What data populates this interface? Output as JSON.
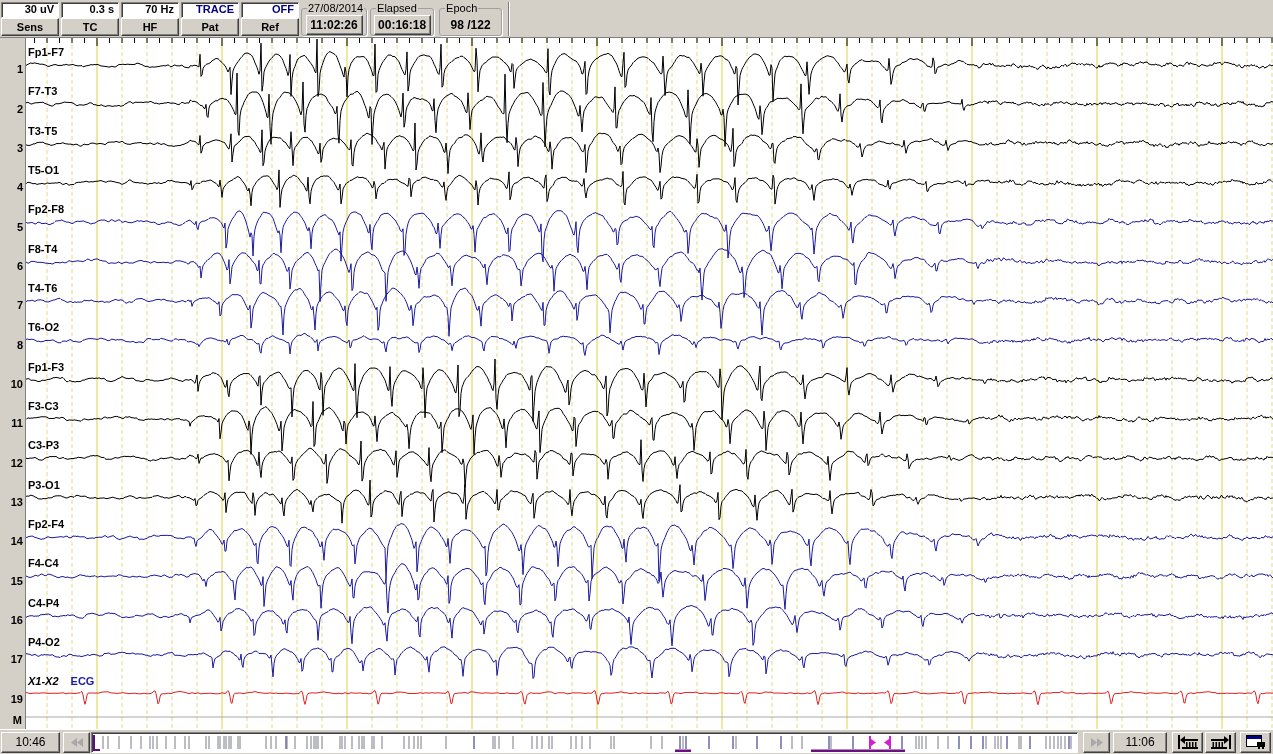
{
  "toolbar": {
    "controls": [
      {
        "value": "30 uV",
        "color": "#000000",
        "button": "Sens"
      },
      {
        "value": "0.3 s",
        "color": "#000000",
        "button": "TC"
      },
      {
        "value": "70 Hz",
        "color": "#000000",
        "button": "HF"
      },
      {
        "value": "TRACE",
        "color": "#000080",
        "button": "Pat"
      },
      {
        "value": "OFF",
        "color": "#000080",
        "button": "Ref"
      }
    ],
    "clock": {
      "legend": "27/08/2014",
      "value": "11:02:26"
    },
    "elapsed": {
      "legend": "Elapsed",
      "value": "00:16:18"
    },
    "epoch": {
      "legend": "Epoch",
      "value": "98 /122"
    }
  },
  "channels": [
    {
      "number": "1",
      "label": "Fp1-F7",
      "kind": "eeg",
      "color": "#000000"
    },
    {
      "number": "2",
      "label": "F7-T3",
      "kind": "eeg",
      "color": "#000000"
    },
    {
      "number": "3",
      "label": "T3-T5",
      "kind": "eeg",
      "color": "#000000"
    },
    {
      "number": "4",
      "label": "T5-O1",
      "kind": "eeg",
      "color": "#000000"
    },
    {
      "number": "5",
      "label": "Fp2-F8",
      "kind": "eeg",
      "color": "#1a1aa0"
    },
    {
      "number": "6",
      "label": "F8-T4",
      "kind": "eeg",
      "color": "#1a1aa0"
    },
    {
      "number": "7",
      "label": "T4-T6",
      "kind": "eeg",
      "color": "#1a1aa0"
    },
    {
      "number": "8",
      "label": "T6-O2",
      "kind": "eeg",
      "color": "#1a1aa0"
    },
    {
      "number": "10",
      "label": "Fp1-F3",
      "kind": "eeg",
      "color": "#000000"
    },
    {
      "number": "11",
      "label": "F3-C3",
      "kind": "eeg",
      "color": "#000000"
    },
    {
      "number": "12",
      "label": "C3-P3",
      "kind": "eeg",
      "color": "#000000"
    },
    {
      "number": "13",
      "label": "P3-O1",
      "kind": "eeg",
      "color": "#000000"
    },
    {
      "number": "14",
      "label": "Fp2-F4",
      "kind": "eeg",
      "color": "#1a1aa0"
    },
    {
      "number": "15",
      "label": "F4-C4",
      "kind": "eeg",
      "color": "#1a1aa0"
    },
    {
      "number": "16",
      "label": "C4-P4",
      "kind": "eeg",
      "color": "#1a1aa0"
    },
    {
      "number": "17",
      "label": "P4-O2",
      "kind": "eeg",
      "color": "#1a1aa0"
    },
    {
      "number": "19",
      "label": "X1-X2",
      "kind": "polygraphic",
      "signal_type": "ECG",
      "color": "#e02020"
    }
  ],
  "marker_row": {
    "label": "M"
  },
  "navigator": {
    "start": "10:46",
    "end": "11:06",
    "level": 0.8,
    "rewind_button": {
      "disabled": true
    },
    "forward_button": {
      "disabled": true
    }
  }
}
